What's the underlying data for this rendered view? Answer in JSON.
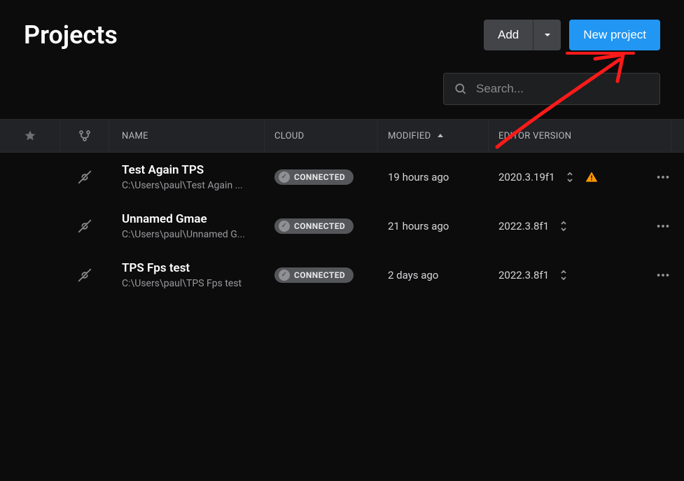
{
  "header": {
    "title": "Projects",
    "add_label": "Add",
    "new_project_label": "New project"
  },
  "search": {
    "placeholder": "Search..."
  },
  "columns": {
    "name": "NAME",
    "cloud": "CLOUD",
    "modified": "MODIFIED",
    "editor_version": "EDITOR VERSION"
  },
  "badge": {
    "connected": "CONNECTED"
  },
  "projects": [
    {
      "name": "Test Again TPS",
      "path": "C:\\Users\\paul\\Test Again ...",
      "cloud_status": "CONNECTED",
      "modified": "19 hours ago",
      "editor_version": "2020.3.19f1",
      "has_warning": true
    },
    {
      "name": "Unnamed Gmae",
      "path": "C:\\Users\\paul\\Unnamed G...",
      "cloud_status": "CONNECTED",
      "modified": "21 hours ago",
      "editor_version": "2022.3.8f1",
      "has_warning": false
    },
    {
      "name": "TPS Fps test",
      "path": "C:\\Users\\paul\\TPS Fps test",
      "cloud_status": "CONNECTED",
      "modified": "2 days ago",
      "editor_version": "2022.3.8f1",
      "has_warning": false
    }
  ],
  "sort": {
    "column": "modified",
    "direction": "asc"
  }
}
